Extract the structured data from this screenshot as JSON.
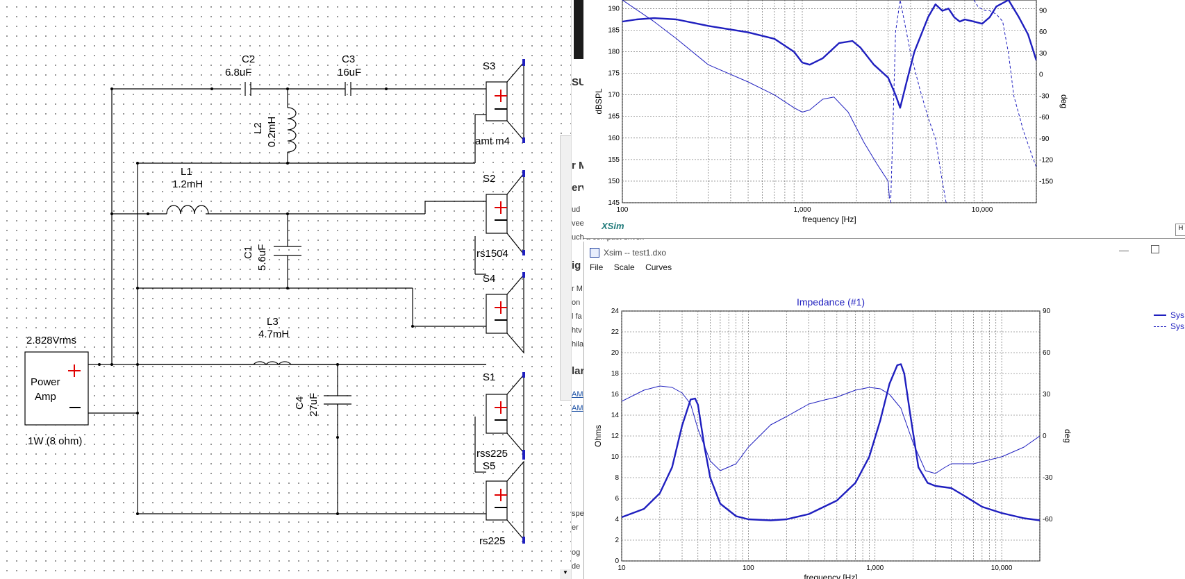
{
  "schematic": {
    "labels": {
      "C2": "C2",
      "C2_val": "6.8uF",
      "C3": "C3",
      "C3_val": "16uF",
      "L2": "L2",
      "L2_val": "0.2mH",
      "L1": "L1",
      "L1_val": "1.2mH",
      "C1": "C1",
      "C1_val": "5.6uF",
      "L3": "L3",
      "L3_val": "4.7mH",
      "C4": "C4",
      "C4_val": "27uF",
      "S3": "S3",
      "S3_name": "amt m4",
      "S2": "S2",
      "S2_name": "rs1504",
      "S4": "S4",
      "S1": "S1",
      "S1_name": "rss225",
      "S5": "S5",
      "S5_name": "rs225",
      "amp_voltage": "2.828Vrms",
      "amp_line1": "Power",
      "amp_line2": "Amp",
      "amp_power": "1W (8 ohm)"
    }
  },
  "background_window": {
    "fragments": [
      "SU",
      "r M",
      "erv",
      "ud",
      "vee",
      "uch a compact driver.",
      "ig",
      "r M",
      "on",
      "l fa",
      "htv",
      "hila",
      "lar",
      "AM",
      "AM",
      "spe",
      "er",
      "og",
      "de"
    ]
  },
  "top_window": {
    "brand": "XSim",
    "right_button": "H"
  },
  "bottom_window": {
    "title": "Xsim -- test1.dxo",
    "minimize": "—",
    "menu": [
      "File",
      "Scale",
      "Curves"
    ],
    "legend": [
      "Sys",
      "Sys"
    ],
    "accent_color": "#1f1fbf"
  },
  "chart_data": [
    {
      "type": "line",
      "title": "",
      "xlabel": "frequency [Hz]",
      "ylabel": "dBSPL",
      "y2label": "deg",
      "x_scale": "log",
      "xlim": [
        100,
        20000
      ],
      "ylim": [
        145,
        192
      ],
      "y2lim": [
        -180,
        105
      ],
      "x_ticks": [
        100,
        1000,
        10000
      ],
      "x_tick_labels": [
        "100",
        "1,000",
        "10,000"
      ],
      "y_ticks": [
        145,
        150,
        155,
        160,
        165,
        170,
        175,
        180,
        185,
        190
      ],
      "y2_ticks": [
        90,
        60,
        30,
        0,
        -30,
        -60,
        -90,
        -120,
        -150
      ],
      "grid": true,
      "series": [
        {
          "name": "",
          "style": "thick",
          "axis": "left",
          "x": [
            100,
            120,
            150,
            200,
            300,
            500,
            700,
            900,
            1000,
            1100,
            1300,
            1600,
            1900,
            2100,
            2500,
            3000,
            3300,
            3500,
            3800,
            4200,
            5000,
            5500,
            6000,
            6500,
            7000,
            7500,
            8000,
            9000,
            10000,
            11000,
            12000,
            14000,
            16000,
            18000,
            20000
          ],
          "y": [
            187,
            187.5,
            187.8,
            187.5,
            186,
            184.5,
            183,
            180,
            177.5,
            177,
            178.5,
            182,
            182.5,
            181,
            177,
            174,
            170,
            167,
            173,
            180,
            188,
            191,
            189.5,
            190,
            188,
            187,
            187.5,
            187,
            186.5,
            188,
            190.5,
            192,
            188,
            184,
            178
          ]
        },
        {
          "name": "",
          "style": "thin",
          "axis": "left",
          "x": [
            100,
            150,
            200,
            300,
            500,
            700,
            900,
            1000,
            1100,
            1300,
            1500,
            1800,
            2200,
            2600,
            3000,
            3050
          ],
          "y": [
            192,
            187,
            183,
            177,
            173,
            170,
            167,
            166,
            166.5,
            169,
            169.5,
            166,
            159,
            154,
            150,
            146
          ]
        },
        {
          "name": "",
          "style": "dashed",
          "axis": "right",
          "x": [
            3100,
            3200,
            3300,
            3500,
            4000,
            4500,
            5000,
            5500,
            6000,
            6300
          ],
          "y": [
            -180,
            -60,
            60,
            105,
            30,
            -20,
            -60,
            -90,
            -150,
            -180
          ]
        },
        {
          "name": "",
          "style": "dashed",
          "axis": "right",
          "x": [
            9000,
            9500,
            10000,
            10500,
            11000,
            12000,
            13000,
            14000,
            15000,
            17000,
            19000,
            20000
          ],
          "y": [
            105,
            95,
            92,
            90,
            90,
            85,
            75,
            30,
            -30,
            -80,
            -115,
            -130
          ]
        }
      ]
    },
    {
      "type": "line",
      "title": "Impedance (#1)",
      "xlabel": "frequency [Hz]",
      "ylabel": "Ohms",
      "y2label": "deg",
      "x_scale": "log",
      "xlim": [
        10,
        20000
      ],
      "ylim": [
        0,
        24
      ],
      "y2lim": [
        -90,
        90
      ],
      "x_ticks": [
        10,
        100,
        1000,
        10000
      ],
      "x_tick_labels": [
        "10",
        "100",
        "1,000",
        "10,000"
      ],
      "y_ticks": [
        0,
        2,
        4,
        6,
        8,
        10,
        12,
        14,
        16,
        18,
        20,
        22,
        24
      ],
      "y2_ticks": [
        90,
        60,
        30,
        0,
        -30,
        -60
      ],
      "grid": true,
      "series": [
        {
          "name": "Sys",
          "style": "thick",
          "axis": "left",
          "x": [
            10,
            15,
            20,
            25,
            30,
            35,
            38,
            40,
            45,
            50,
            60,
            80,
            100,
            150,
            200,
            300,
            500,
            700,
            900,
            1100,
            1300,
            1500,
            1600,
            1700,
            1900,
            2200,
            2600,
            3000,
            4000,
            5000,
            7000,
            10000,
            15000,
            20000
          ],
          "y": [
            4.2,
            5,
            6.5,
            9,
            13,
            15.5,
            15.6,
            15,
            11,
            8,
            5.5,
            4.3,
            4,
            3.9,
            4,
            4.5,
            5.8,
            7.5,
            10,
            13.5,
            17,
            18.8,
            18.9,
            18,
            14,
            9,
            7.5,
            7.2,
            7,
            6.3,
            5.2,
            4.6,
            4.1,
            3.9
          ]
        },
        {
          "name": "Sys",
          "style": "thin",
          "axis": "right",
          "x": [
            10,
            15,
            20,
            25,
            30,
            35,
            40,
            50,
            60,
            80,
            100,
            150,
            200,
            300,
            400,
            500,
            700,
            900,
            1100,
            1300,
            1600,
            2000,
            2500,
            3000,
            3500,
            4000,
            6000,
            10000,
            15000,
            20000
          ],
          "y": [
            25,
            33,
            36,
            35,
            31,
            23,
            5,
            -18,
            -25,
            -20,
            -8,
            8,
            14,
            23,
            26,
            28,
            33,
            35,
            34,
            30,
            20,
            -5,
            -25,
            -27,
            -23,
            -20,
            -20,
            -15,
            -8,
            0
          ]
        }
      ]
    }
  ]
}
